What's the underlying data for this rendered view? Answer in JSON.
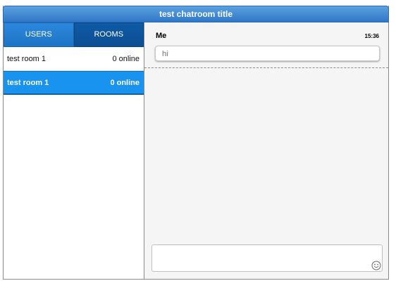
{
  "window": {
    "title": "test chatroom title"
  },
  "tabs": [
    {
      "label": "USERS"
    },
    {
      "label": "ROOMS"
    }
  ],
  "rooms": [
    {
      "name": "test room 1",
      "status": "0 online"
    },
    {
      "name": "test room 1",
      "status": "0 online"
    }
  ],
  "messages": [
    {
      "sender": "Me",
      "time": "15:36",
      "text": "hi"
    }
  ],
  "compose": {
    "value": "",
    "placeholder": ""
  },
  "icons": {
    "emoji": "smiley-face-icon"
  },
  "colors": {
    "accent": "#1e73c5",
    "selected": "#1993f0",
    "title": "#2f77c8"
  }
}
